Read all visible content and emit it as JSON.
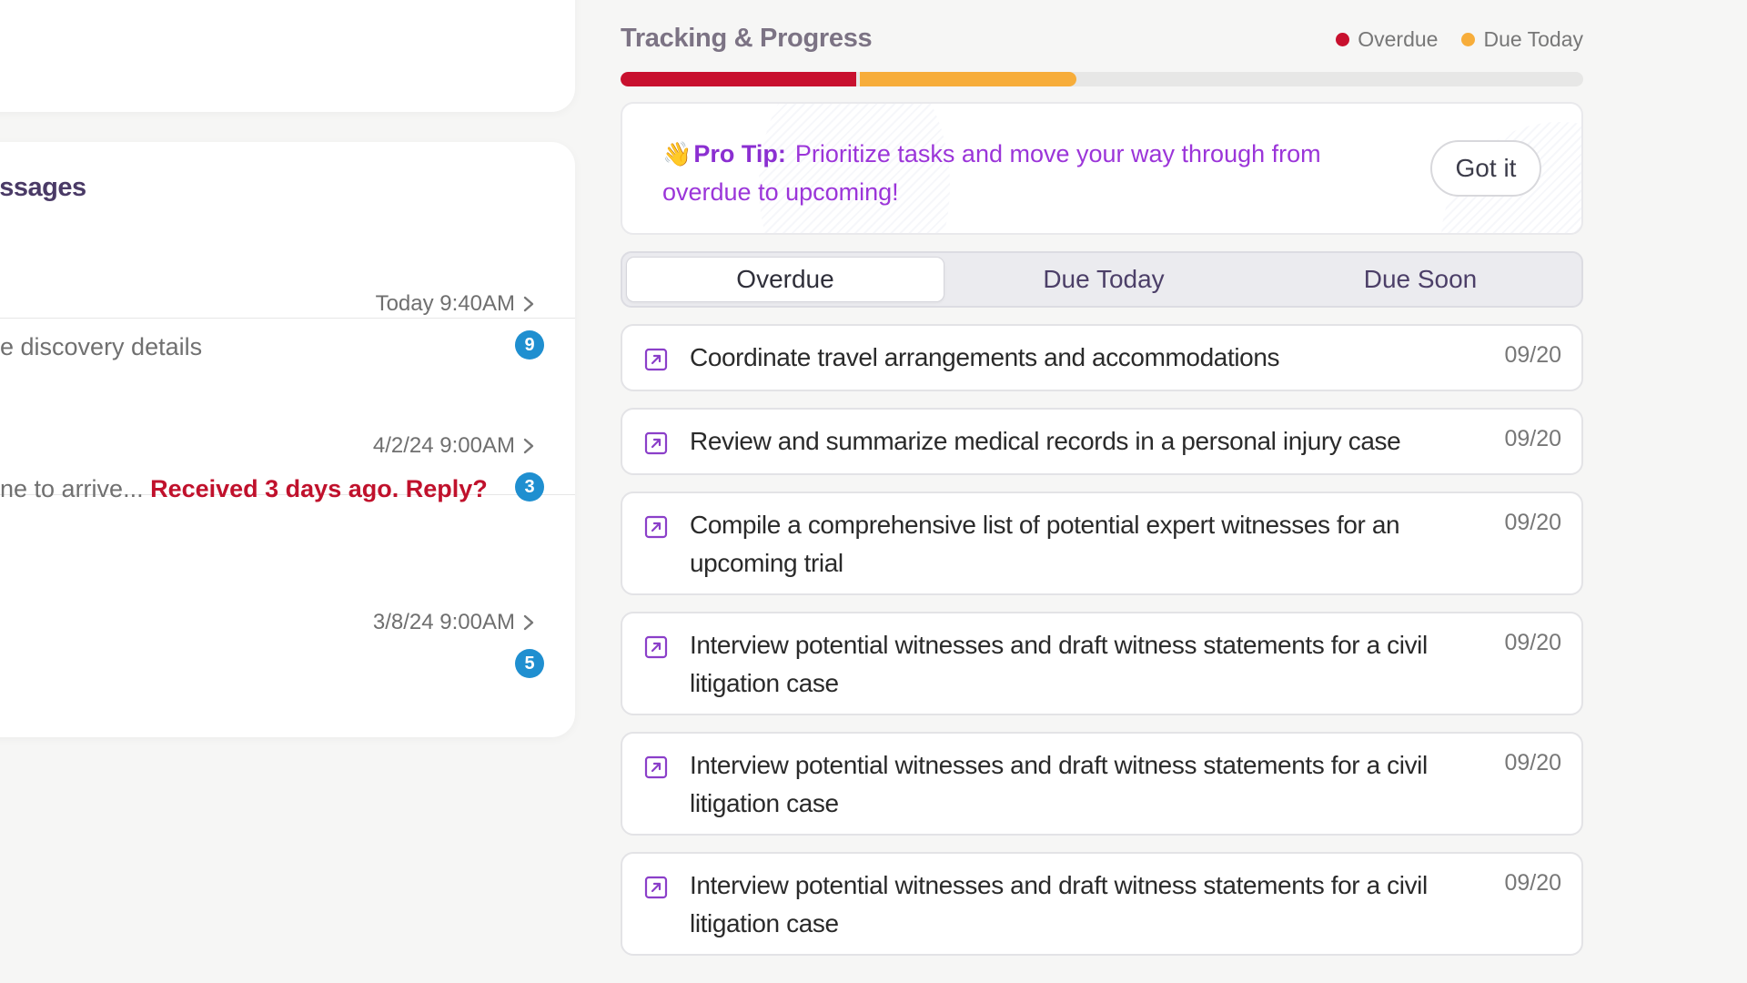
{
  "messages": {
    "title": "Messages",
    "rows": [
      {
        "time": "Today 9:40AM",
        "snippet": "e discovery details",
        "alert": "",
        "badge": "9"
      },
      {
        "time": "4/2/24 9:00AM",
        "snippet": "ne to arrive... ",
        "alert": "Received 3 days ago. Reply?",
        "badge": "3"
      },
      {
        "time": "3/8/24 9:00AM",
        "snippet": "",
        "alert": "",
        "badge": "5"
      }
    ]
  },
  "tracking": {
    "title": "Tracking & Progress",
    "legend": [
      {
        "label": "Overdue",
        "color": "#c8102e"
      },
      {
        "label": "Due Today",
        "color": "#f7ad3a"
      }
    ],
    "progress": {
      "overdue_fraction": 0.245,
      "due_today_fraction": 0.225
    }
  },
  "tip": {
    "emoji": "👋",
    "label": "Pro Tip:",
    "text": "Prioritize tasks and move your way through from overdue to upcoming!",
    "button": "Got it"
  },
  "tabs": [
    {
      "label": "Overdue",
      "active": true
    },
    {
      "label": "Due Today",
      "active": false
    },
    {
      "label": "Due Soon",
      "active": false
    }
  ],
  "tasks": [
    {
      "text": "Coordinate travel arrangements and accommodations",
      "date": "09/20"
    },
    {
      "text": "Review and summarize medical records in a personal injury case",
      "date": "09/20"
    },
    {
      "text": "Compile a comprehensive list of potential expert witnesses for an upcoming trial",
      "date": "09/20"
    },
    {
      "text": "Interview potential witnesses and draft witness statements for a civil litigation case",
      "date": "09/20"
    },
    {
      "text": "Interview potential witnesses and draft witness statements for a civil litigation case",
      "date": "09/20"
    },
    {
      "text": "Interview potential witnesses and draft witness statements for a civil litigation case",
      "date": "09/20"
    }
  ],
  "colors": {
    "accent_purple": "#8b2fd1",
    "badge_blue": "#1f8fd0",
    "alert_red": "#c0112c"
  }
}
